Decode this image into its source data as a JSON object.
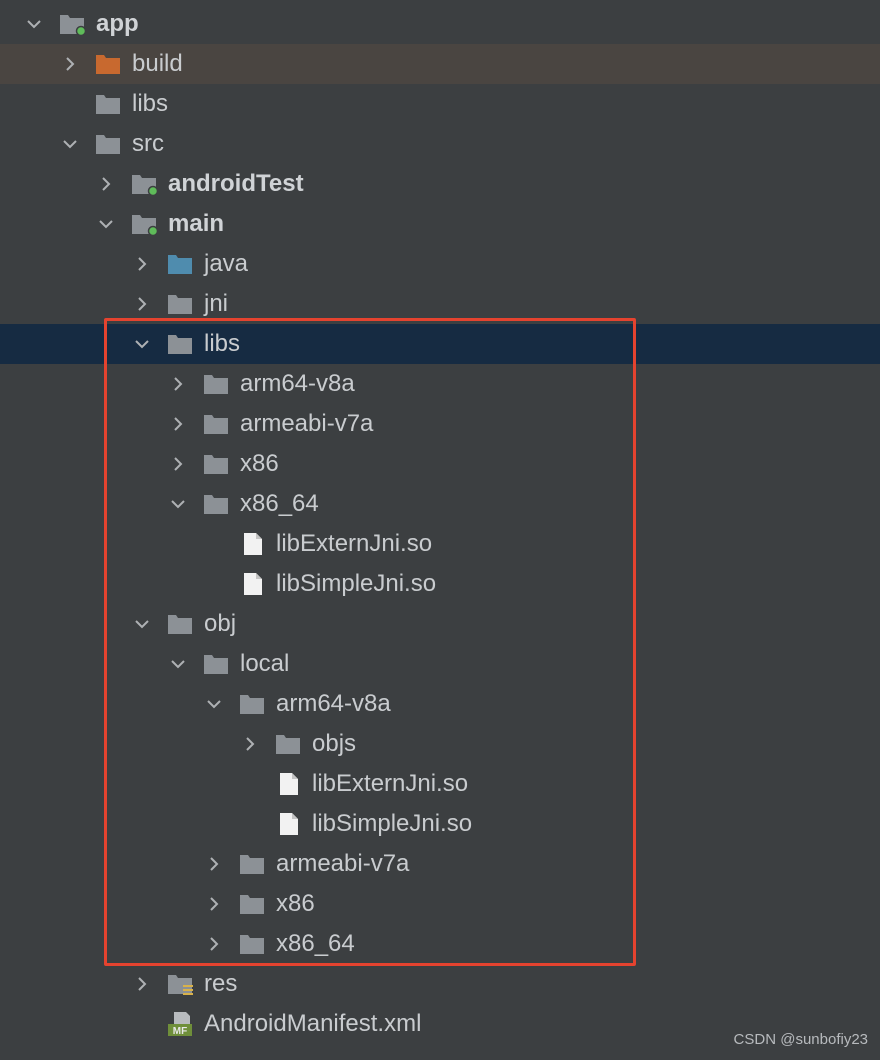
{
  "colors": {
    "background": "#3c3f41",
    "selected_row": "#162b42",
    "highlight_row": "#4a4541",
    "folder_gray": "#8c9196",
    "folder_blue": "#4f8cae",
    "folder_orange": "#c8692f",
    "module_dot": "#5fbc5a",
    "annotation_red": "#e5432f"
  },
  "tree": {
    "app": {
      "label": "app",
      "icon": "module-folder-icon"
    },
    "build": {
      "label": "build",
      "icon": "excluded-folder-icon"
    },
    "libs_top": {
      "label": "libs",
      "icon": "folder-icon"
    },
    "src": {
      "label": "src",
      "icon": "folder-icon"
    },
    "androidTest": {
      "label": "androidTest",
      "icon": "module-folder-icon"
    },
    "main": {
      "label": "main",
      "icon": "module-folder-icon"
    },
    "java": {
      "label": "java",
      "icon": "source-folder-icon"
    },
    "jni": {
      "label": "jni",
      "icon": "folder-icon"
    },
    "libs": {
      "label": "libs",
      "icon": "folder-icon"
    },
    "libs_arm64": {
      "label": "arm64-v8a",
      "icon": "folder-icon"
    },
    "libs_armeabi": {
      "label": "armeabi-v7a",
      "icon": "folder-icon"
    },
    "libs_x86": {
      "label": "x86",
      "icon": "folder-icon"
    },
    "libs_x86_64": {
      "label": "x86_64",
      "icon": "folder-icon"
    },
    "libs_x86_64_extern": {
      "label": "libExternJni.so",
      "icon": "file-icon"
    },
    "libs_x86_64_simple": {
      "label": "libSimpleJni.so",
      "icon": "file-icon"
    },
    "obj": {
      "label": "obj",
      "icon": "folder-icon"
    },
    "local": {
      "label": "local",
      "icon": "folder-icon"
    },
    "local_arm64": {
      "label": "arm64-v8a",
      "icon": "folder-icon"
    },
    "objs": {
      "label": "objs",
      "icon": "folder-icon"
    },
    "local_arm64_extern": {
      "label": "libExternJni.so",
      "icon": "file-icon"
    },
    "local_arm64_simple": {
      "label": "libSimpleJni.so",
      "icon": "file-icon"
    },
    "local_armeabi": {
      "label": "armeabi-v7a",
      "icon": "folder-icon"
    },
    "local_x86": {
      "label": "x86",
      "icon": "folder-icon"
    },
    "local_x86_64": {
      "label": "x86_64",
      "icon": "folder-icon"
    },
    "res": {
      "label": "res",
      "icon": "resource-folder-icon"
    },
    "manifest": {
      "label": "AndroidManifest.xml",
      "icon": "manifest-file-icon"
    }
  },
  "watermark": "CSDN @sunbofiy23"
}
